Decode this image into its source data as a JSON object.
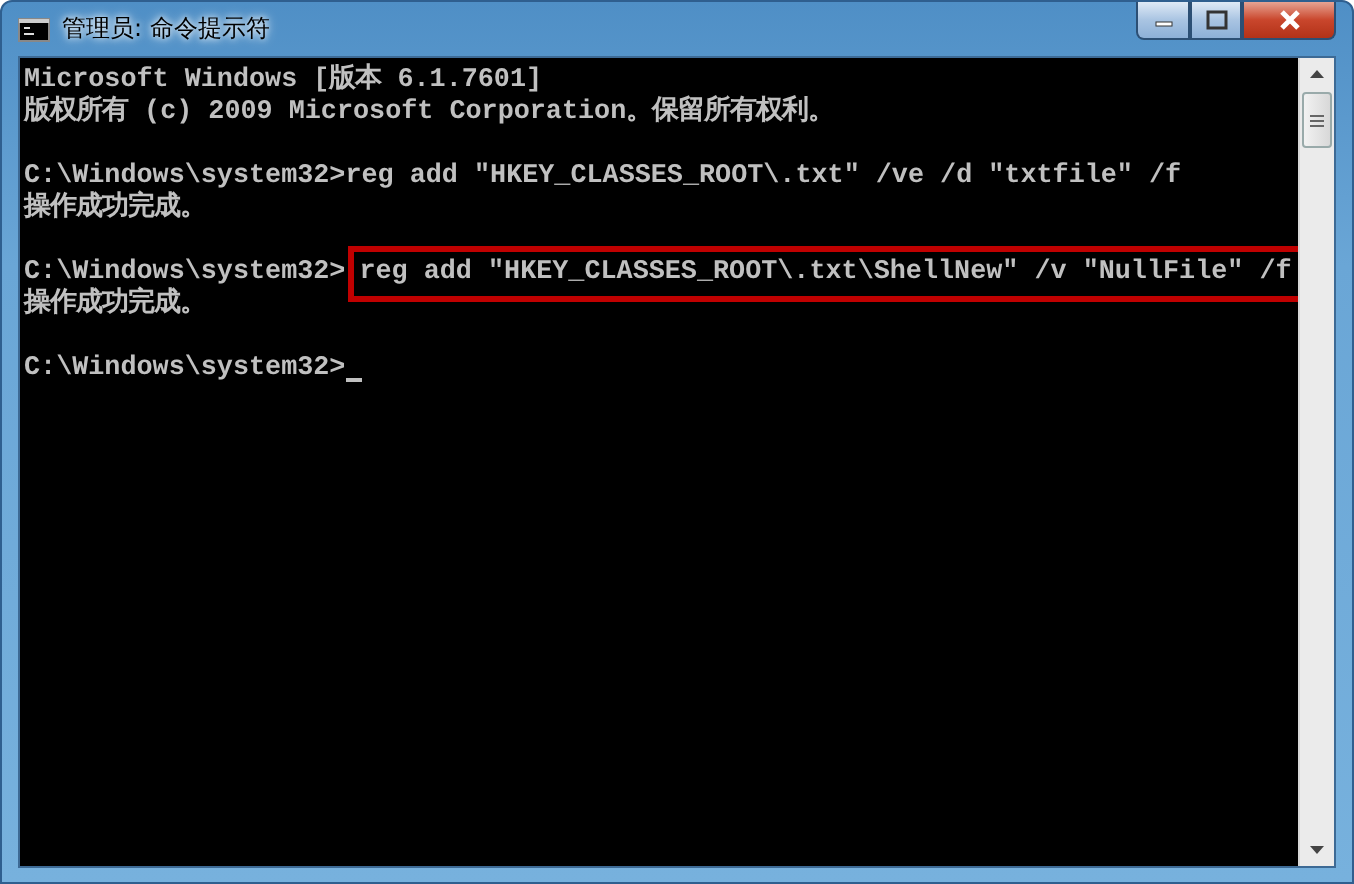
{
  "window": {
    "title": "管理员: 命令提示符"
  },
  "console": {
    "lines": [
      {
        "kind": "text",
        "text": "Microsoft Windows [版本 6.1.7601]"
      },
      {
        "kind": "text",
        "text": "版权所有 (c) 2009 Microsoft Corporation。保留所有权利。"
      },
      {
        "kind": "blank"
      },
      {
        "kind": "prompt",
        "prompt": "C:\\Windows\\system32>",
        "command": "reg add \"HKEY_CLASSES_ROOT\\.txt\" /ve /d \"txtfile\" /f"
      },
      {
        "kind": "text",
        "text": "操作成功完成。"
      },
      {
        "kind": "blank"
      },
      {
        "kind": "prompt_highlighted",
        "prompt": "C:\\Windows\\system32>",
        "command": "reg add \"HKEY_CLASSES_ROOT\\.txt\\ShellNew\" /v \"NullFile\" /f"
      },
      {
        "kind": "text",
        "text": "操作成功完成。"
      },
      {
        "kind": "blank"
      },
      {
        "kind": "prompt_cursor",
        "prompt": "C:\\Windows\\system32>"
      }
    ]
  }
}
